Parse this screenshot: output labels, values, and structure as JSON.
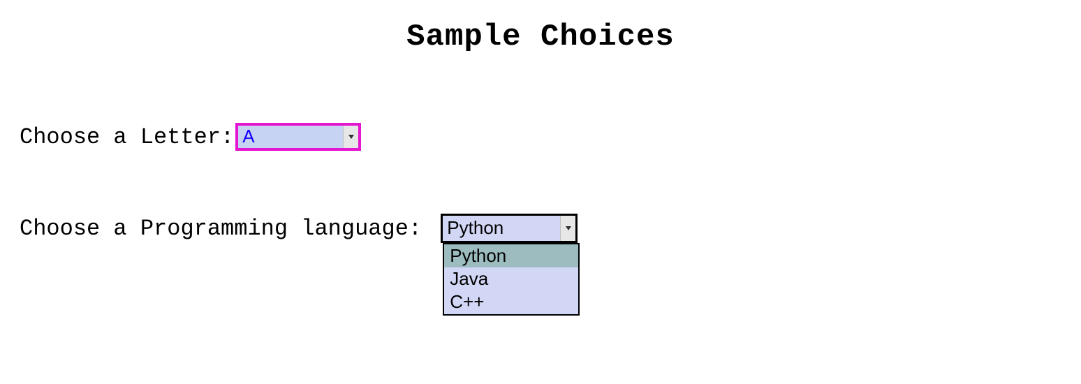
{
  "title": "Sample Choices",
  "letter": {
    "label": "Choose a Letter:",
    "value": "A"
  },
  "language": {
    "label": "Choose a Programming language: ",
    "value": "Python",
    "options": [
      "Python",
      "Java",
      "C++"
    ],
    "highlighted_index": 0,
    "dropdown_open": true
  }
}
